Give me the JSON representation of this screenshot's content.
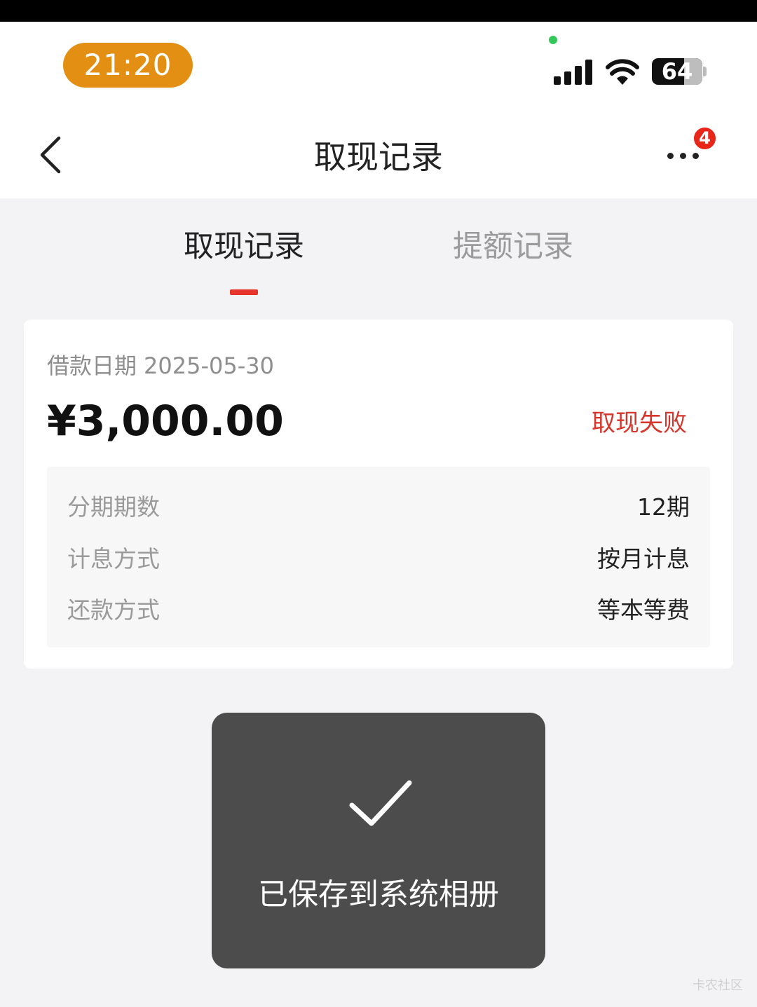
{
  "status_bar": {
    "time": "21:20",
    "battery": "64"
  },
  "nav": {
    "title": "取现记录",
    "badge_count": "4"
  },
  "tabs": [
    {
      "label": "取现记录",
      "active": true
    },
    {
      "label": "提额记录",
      "active": false
    }
  ],
  "record": {
    "date_label": "借款日期",
    "date_value": "2025-05-30",
    "amount": "¥3,000.00",
    "status": "取现失败",
    "details": [
      {
        "label": "分期期数",
        "value": "12期"
      },
      {
        "label": "计息方式",
        "value": "按月计息"
      },
      {
        "label": "还款方式",
        "value": "等本等费"
      }
    ]
  },
  "toast": {
    "message": "已保存到系统相册"
  },
  "watermark": "卡农社区",
  "colors": {
    "accent": "#e6362c",
    "status_fail": "#d5352b",
    "time_pill": "#e38f13",
    "toast_bg": "#4c4c4c"
  }
}
